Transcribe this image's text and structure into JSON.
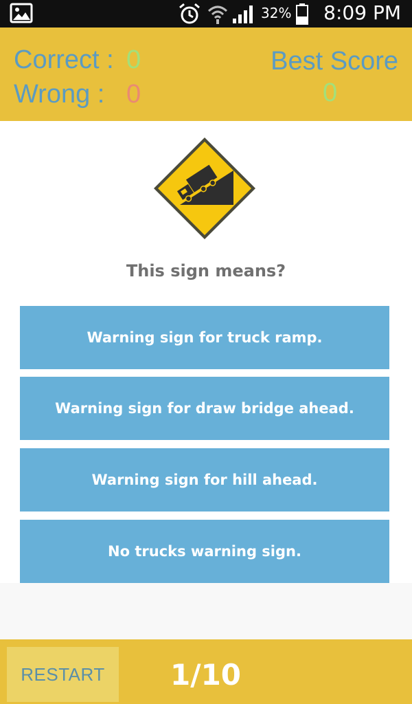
{
  "status_bar": {
    "battery_percent": "32%",
    "time": "8:09 PM",
    "icons": [
      "gallery-icon",
      "alarm-icon",
      "wifi-icon",
      "signal-icon",
      "battery-icon"
    ]
  },
  "score": {
    "correct_label": "Correct :",
    "correct_value": "0",
    "wrong_label": "Wrong :",
    "wrong_value": "0",
    "best_label": "Best Score",
    "best_value": "0"
  },
  "quiz": {
    "sign_icon": "truck-downhill-grade-sign-icon",
    "question": "This sign means?",
    "answers": [
      "Warning sign for truck ramp.",
      "Warning sign for draw bridge ahead.",
      "Warning sign for hill ahead.",
      "No trucks warning sign."
    ]
  },
  "footer": {
    "restart_label": "RESTART",
    "progress": "1/10"
  },
  "colors": {
    "header_bg": "#e8c03c",
    "label_blue": "#5b9bc2",
    "correct_green": "#a3e07a",
    "wrong_red": "#ea8a72",
    "answer_blue": "#67b0d8",
    "restart_bg": "#ecd366"
  }
}
